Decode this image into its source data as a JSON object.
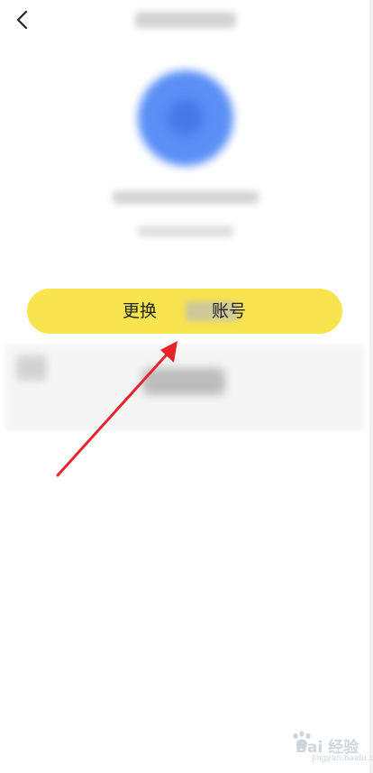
{
  "switch_button": {
    "label_prefix": "更换",
    "label_suffix": "账号"
  },
  "watermark": {
    "brand": "Bai  经验",
    "url": "jingyan.baidu.com"
  },
  "colors": {
    "accent_yellow": "#f8e44f",
    "avatar_blue": "#5b8ff6",
    "arrow_red": "#e5242c"
  }
}
